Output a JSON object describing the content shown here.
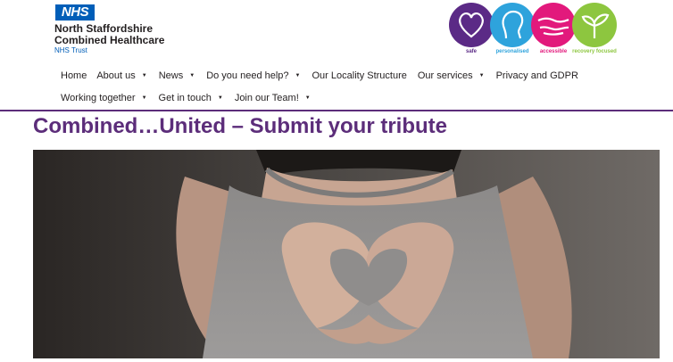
{
  "logo": {
    "badge": "NHS",
    "line1": "North Staffordshire",
    "line2": "Combined Healthcare",
    "sub": "NHS Trust"
  },
  "values": [
    {
      "label": "safe",
      "color": "#5b2a86",
      "icon": "heart-icon"
    },
    {
      "label": "personalised",
      "color": "#2ea3dc",
      "icon": "person-head-icon"
    },
    {
      "label": "accessible",
      "color": "#e2197c",
      "icon": "handshake-icon"
    },
    {
      "label": "recovery focused",
      "color": "#8dc63f",
      "icon": "sprout-icon"
    }
  ],
  "nav": {
    "row1": [
      {
        "label": "Home",
        "dropdown": false
      },
      {
        "label": "About us",
        "dropdown": true
      },
      {
        "label": "News",
        "dropdown": true
      },
      {
        "label": "Do you need help?",
        "dropdown": true
      },
      {
        "label": "Our Locality Structure",
        "dropdown": false
      },
      {
        "label": "Our services",
        "dropdown": true
      },
      {
        "label": "Privacy and GDPR",
        "dropdown": false
      }
    ],
    "row2": [
      {
        "label": "Working together",
        "dropdown": true
      },
      {
        "label": "Get in touch",
        "dropdown": true
      },
      {
        "label": "Join our Team!",
        "dropdown": true
      }
    ]
  },
  "page": {
    "title": "Combined…United – Submit your tribute"
  },
  "hero": {
    "icon": "heart-hands-photo"
  },
  "colors": {
    "brand_purple": "#5c2d7a",
    "nhs_blue": "#005eb8"
  }
}
